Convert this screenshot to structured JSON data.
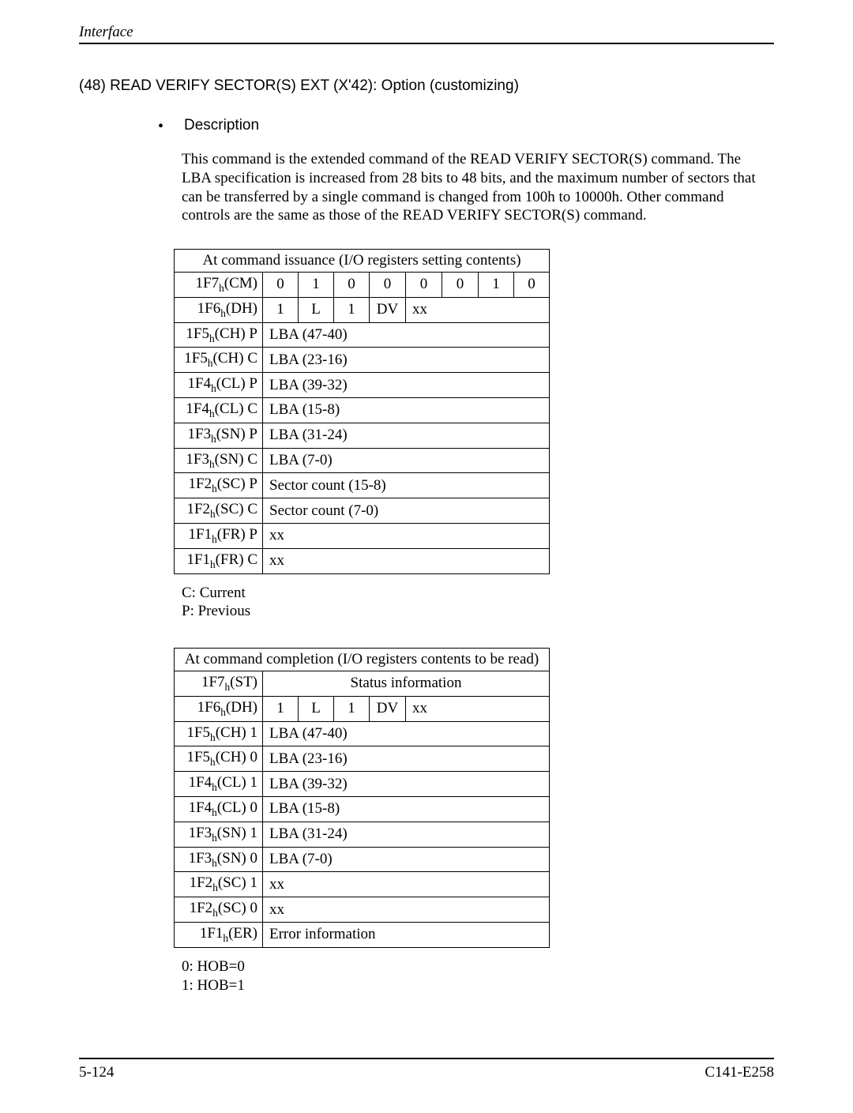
{
  "header": "Interface",
  "section_title": "(48)  READ VERIFY SECTOR(S) EXT (X'42):  Option (customizing)",
  "bullet_label": "Description",
  "description": "This command is the extended command of the READ VERIFY SECTOR(S) command.  The LBA specification is increased from 28 bits to 48 bits, and the maximum number of sectors that can be transferred by a single command is changed from 100h to 10000h.  Other command controls are the same as those of the READ VERIFY SECTOR(S) command.",
  "table1": {
    "title": "At command issuance (I/O registers setting contents)",
    "rows": {
      "r0_label": "1F7",
      "r0_sub": "h",
      "r0_suf": "(CM)",
      "r0_b": [
        "0",
        "1",
        "0",
        "0",
        "0",
        "0",
        "1",
        "0"
      ],
      "r1_label": "1F6",
      "r1_sub": "h",
      "r1_suf": "(DH)",
      "r1_b0": "1",
      "r1_b1": "L",
      "r1_b2": "1",
      "r1_b3": "DV",
      "r1_b4": "xx",
      "r2_label": "1F5",
      "r2_sub": "h",
      "r2_suf": "(CH) P",
      "r2_val": "LBA (47-40)",
      "r3_label": "1F5",
      "r3_sub": "h",
      "r3_suf": "(CH) C",
      "r3_val": "LBA (23-16)",
      "r4_label": "1F4",
      "r4_sub": "h",
      "r4_suf": "(CL) P",
      "r4_val": "LBA (39-32)",
      "r5_label": "1F4",
      "r5_sub": "h",
      "r5_suf": "(CL) C",
      "r5_val": "LBA (15-8)",
      "r6_label": "1F3",
      "r6_sub": "h",
      "r6_suf": "(SN) P",
      "r6_val": "LBA (31-24)",
      "r7_label": "1F3",
      "r7_sub": "h",
      "r7_suf": "(SN) C",
      "r7_val": "LBA (7-0)",
      "r8_label": "1F2",
      "r8_sub": "h",
      "r8_suf": "(SC) P",
      "r8_val": "Sector count (15-8)",
      "r9_label": "1F2",
      "r9_sub": "h",
      "r9_suf": "(SC) C",
      "r9_val": "Sector count (7-0)",
      "r10_label": "1F1",
      "r10_sub": "h",
      "r10_suf": "(FR) P",
      "r10_val": "xx",
      "r11_label": "1F1",
      "r11_sub": "h",
      "r11_suf": "(FR) C",
      "r11_val": "xx"
    }
  },
  "legend1_line1": "C:  Current",
  "legend1_line2": "P:  Previous",
  "table2": {
    "title": "At command completion (I/O registers contents to be read)",
    "rows": {
      "r0_label": "1F7",
      "r0_sub": "h",
      "r0_suf": "(ST)",
      "r0_val": "Status information",
      "r1_label": "1F6",
      "r1_sub": "h",
      "r1_suf": "(DH)",
      "r1_b0": "1",
      "r1_b1": "L",
      "r1_b2": "1",
      "r1_b3": "DV",
      "r1_b4": "xx",
      "r2_label": "1F5",
      "r2_sub": "h",
      "r2_suf": "(CH) 1",
      "r2_val": "LBA (47-40)",
      "r3_label": "1F5",
      "r3_sub": "h",
      "r3_suf": "(CH) 0",
      "r3_val": "LBA (23-16)",
      "r4_label": "1F4",
      "r4_sub": "h",
      "r4_suf": "(CL) 1",
      "r4_val": "LBA (39-32)",
      "r5_label": "1F4",
      "r5_sub": "h",
      "r5_suf": "(CL) 0",
      "r5_val": "LBA (15-8)",
      "r6_label": "1F3",
      "r6_sub": "h",
      "r6_suf": "(SN) 1",
      "r6_val": "LBA (31-24)",
      "r7_label": "1F3",
      "r7_sub": "h",
      "r7_suf": "(SN) 0",
      "r7_val": "LBA (7-0)",
      "r8_label": "1F2",
      "r8_sub": "h",
      "r8_suf": "(SC) 1",
      "r8_val": "xx",
      "r9_label": "1F2",
      "r9_sub": "h",
      "r9_suf": "(SC) 0",
      "r9_val": "xx",
      "r10_label": "1F1",
      "r10_sub": "h",
      "r10_suf": "(ER)",
      "r10_val": "Error information"
    }
  },
  "legend2_line1": "0:  HOB=0",
  "legend2_line2": "1:  HOB=1",
  "footer_left": "5-124",
  "footer_right": "C141-E258"
}
